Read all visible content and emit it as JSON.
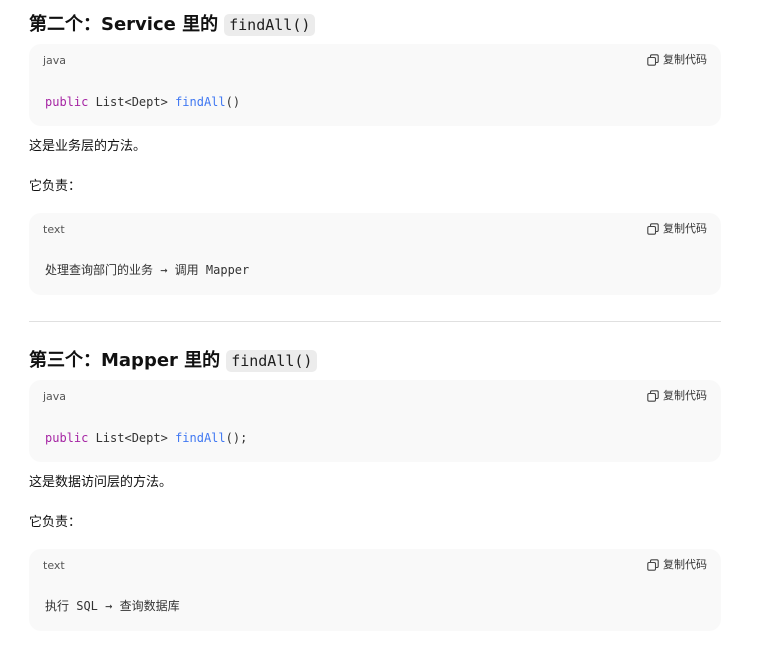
{
  "section2": {
    "heading": "第二个：Service 里的",
    "heading_code": "findAll()",
    "code1": {
      "lang": "java",
      "copy_label": "复制代码",
      "tokens": {
        "kw": "public",
        "type": " List<Dept> ",
        "fn": "findAll",
        "tail": "()"
      }
    },
    "para1": "这是业务层的方法。",
    "para2": "它负责：",
    "code2": {
      "lang": "text",
      "copy_label": "复制代码",
      "line": "处理查询部门的业务 → 调用 Mapper"
    }
  },
  "section3": {
    "heading": "第三个：Mapper 里的",
    "heading_code": "findAll()",
    "code1": {
      "lang": "java",
      "copy_label": "复制代码",
      "tokens": {
        "kw": "public",
        "type": " List<Dept> ",
        "fn": "findAll",
        "tail": "();"
      }
    },
    "para1": "这是数据访问层的方法。",
    "para2": "它负责：",
    "code2": {
      "lang": "text",
      "copy_label": "复制代码",
      "line": "执行 SQL → 查询数据库"
    }
  },
  "icons": {
    "copy": "copy-icon"
  },
  "colors": {
    "keyword": "#a626a4",
    "function": "#4078f2",
    "code_bg": "#f9f9f9",
    "inline_code_bg": "#ececec"
  }
}
